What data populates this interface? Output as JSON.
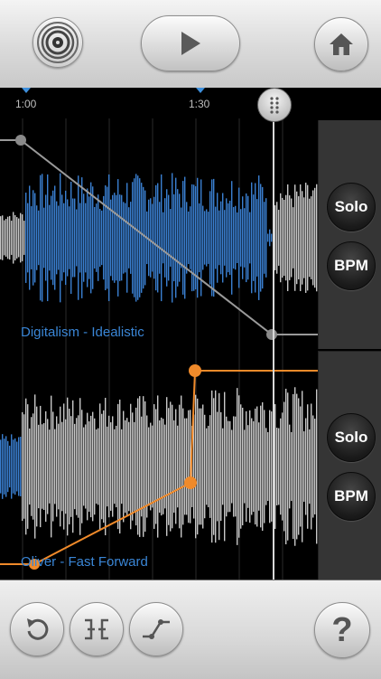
{
  "timeline": {
    "markers": [
      {
        "label": "1:00"
      },
      {
        "label": "1:30"
      }
    ]
  },
  "tracks": [
    {
      "name": "Digitalism - Idealistic",
      "solo_label": "Solo",
      "bpm_label": "BPM"
    },
    {
      "name": "Oliver - Fast Forward",
      "solo_label": "Solo",
      "bpm_label": "BPM"
    }
  ],
  "bottombar": {
    "help_label": "?"
  },
  "icons": {
    "logo": "vinyl-logo-icon",
    "play": "play-icon",
    "home": "home-icon",
    "undo": "undo-icon",
    "split": "split-icon",
    "curve": "crossfade-curve-icon",
    "playhead": "playhead-grip-icon"
  },
  "colors": {
    "waveform_blue": "#3a7fd0",
    "waveform_gray": "#c8c8c8",
    "fade_orange": "#f08a2a",
    "fade_gray": "#9a9a9a",
    "label_blue": "#3a86d6"
  }
}
